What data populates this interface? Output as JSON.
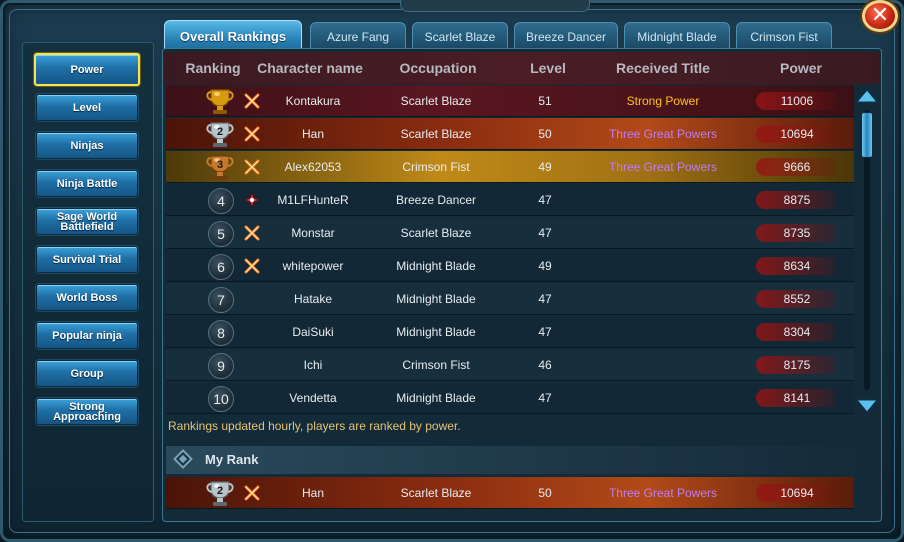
{
  "tabs": [
    "Overall Rankings",
    "Azure Fang",
    "Scarlet Blaze",
    "Breeze Dancer",
    "Midnight Blade",
    "Crimson Fist"
  ],
  "sidebar": [
    {
      "label": "Power",
      "active": true
    },
    {
      "label": "Level"
    },
    {
      "label": "Ninjas"
    },
    {
      "label": "Ninja Battle"
    },
    {
      "label": "Sage World Battlefield"
    },
    {
      "label": "Survival Trial"
    },
    {
      "label": "World Boss"
    },
    {
      "label": "Popular ninja"
    },
    {
      "label": "Group"
    },
    {
      "label": "Strong Approaching"
    }
  ],
  "columns": {
    "ranking": "Ranking",
    "name": "Character name",
    "occupation": "Occupation",
    "level": "Level",
    "title": "Received Title",
    "power": "Power"
  },
  "rows": [
    {
      "rank": "1",
      "name": "Kontakura",
      "occupation": "Scarlet Blaze",
      "level": "51",
      "title": "Strong Power",
      "power": "11006",
      "trophy": "gold",
      "occ_icon": "scarlet"
    },
    {
      "rank": "2",
      "name": "Han",
      "occupation": "Scarlet Blaze",
      "level": "50",
      "title": "Three Great Powers",
      "power": "10694",
      "trophy": "silver",
      "occ_icon": "scarlet"
    },
    {
      "rank": "3",
      "name": "Alex62053",
      "occupation": "Crimson Fist",
      "level": "49",
      "title": "Three Great Powers",
      "power": "9666",
      "trophy": "bronze",
      "occ_icon": "scarlet"
    },
    {
      "rank": "4",
      "name": "M1LFHunteR",
      "occupation": "Breeze Dancer",
      "level": "47",
      "title": "",
      "power": "8875",
      "occ_icon": "breeze"
    },
    {
      "rank": "5",
      "name": "Monstar",
      "occupation": "Scarlet Blaze",
      "level": "47",
      "title": "",
      "power": "8735",
      "occ_icon": "scarlet"
    },
    {
      "rank": "6",
      "name": "whitepower",
      "occupation": "Midnight Blade",
      "level": "49",
      "title": "",
      "power": "8634",
      "occ_icon": "scarlet"
    },
    {
      "rank": "7",
      "name": "Hatake",
      "occupation": "Midnight Blade",
      "level": "47",
      "title": "",
      "power": "8552"
    },
    {
      "rank": "8",
      "name": "DaiSuki",
      "occupation": "Midnight Blade",
      "level": "47",
      "title": "",
      "power": "8304"
    },
    {
      "rank": "9",
      "name": "Ichi",
      "occupation": "Crimson Fist",
      "level": "46",
      "title": "",
      "power": "8175"
    },
    {
      "rank": "10",
      "name": "Vendetta",
      "occupation": "Midnight Blade",
      "level": "47",
      "title": "",
      "power": "8141"
    }
  ],
  "note": "Rankings updated hourly, players are ranked by power.",
  "my_rank": {
    "label": "My Rank",
    "rank": "2",
    "name": "Han",
    "occupation": "Scarlet Blaze",
    "level": "50",
    "title": "Three Great Powers",
    "power": "10694",
    "trophy": "silver",
    "occ_icon": "scarlet"
  },
  "colors": {
    "title_orange": "#ffc21a",
    "title_purple": "#c07cf2",
    "accent": "#2a84b8"
  }
}
